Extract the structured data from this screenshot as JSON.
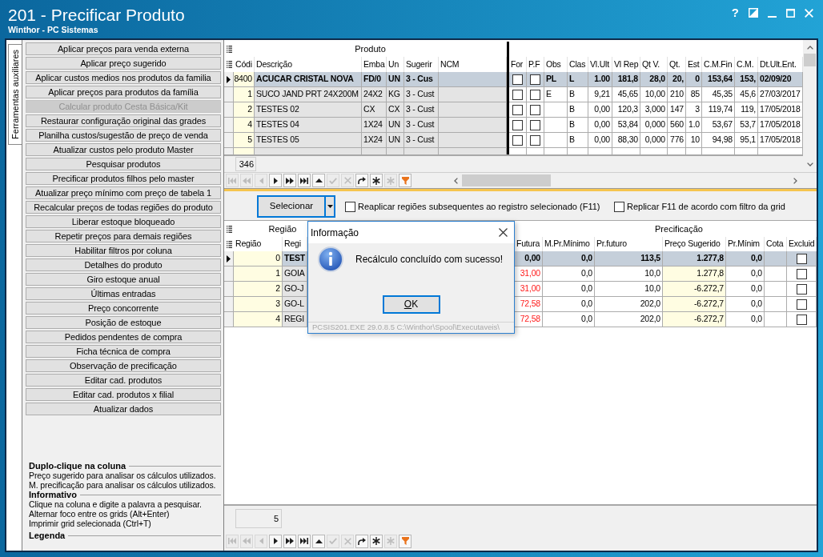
{
  "window": {
    "title": "201 - Precificar Produto",
    "subtitle": "Winthor - PC Sistemas",
    "help": "?"
  },
  "side_tabs": [
    {
      "label": "Ferramentas auxiliares",
      "selected": true
    }
  ],
  "actions": [
    {
      "label": "Aplicar preços para venda externa",
      "disabled": false
    },
    {
      "label": "Aplicar preço sugerido",
      "disabled": false
    },
    {
      "label": "Aplicar custos medios nos produtos da familia",
      "disabled": false
    },
    {
      "label": "Aplicar preços para produtos da família",
      "disabled": false
    },
    {
      "label": "Calcular produto Cesta Básica/Kit",
      "disabled": true
    },
    {
      "label": "Restaurar configuração original das grades",
      "disabled": false
    },
    {
      "label": "Planilha custos/sugestão de preço de venda",
      "disabled": false
    },
    {
      "label": "Atualizar custos pelo produto Master",
      "disabled": false
    },
    {
      "label": "Pesquisar produtos",
      "disabled": false
    },
    {
      "label": "Precificar produtos filhos pelo master",
      "disabled": false
    },
    {
      "label": "Atualizar preço mínimo com preço de tabela 1",
      "disabled": false
    },
    {
      "label": "Recalcular preços de todas regiões do produto",
      "disabled": false
    },
    {
      "label": "Liberar estoque bloqueado",
      "disabled": false
    },
    {
      "label": "Repetir preços para demais regiões",
      "disabled": false
    },
    {
      "label": "Habilitar filtros por coluna",
      "disabled": false
    },
    {
      "label": "Detalhes do produto",
      "disabled": false
    },
    {
      "label": "Giro estoque anual",
      "disabled": false
    },
    {
      "label": "Últimas entradas",
      "disabled": false
    },
    {
      "label": "Preço concorrente",
      "disabled": false
    },
    {
      "label": "Posição de estoque",
      "disabled": false
    },
    {
      "label": "Pedidos pendentes de compra",
      "disabled": false
    },
    {
      "label": "Ficha técnica de compra",
      "disabled": false
    },
    {
      "label": "Observação de precificação",
      "disabled": false
    },
    {
      "label": "Editar cad. produtos",
      "disabled": false
    },
    {
      "label": "Editar cad. produtos x filial",
      "disabled": false
    },
    {
      "label": "Atualizar dados",
      "disabled": false
    }
  ],
  "legend_sections": [
    {
      "heading": "Duplo-clique na coluna",
      "lines": [
        "Preço sugerido para analisar os cálculos utilizados.",
        "M. precificação para analisar os cálculos utilizados."
      ]
    },
    {
      "heading": "Informativo",
      "lines": [
        "Clique na coluna e digite a palavra a pesquisar.",
        "Alternar foco entre os grids (Alt+Enter)",
        "Imprimir grid selecionada (Ctrl+T)"
      ]
    },
    {
      "heading": "Legenda"
    }
  ],
  "product_grid": {
    "band": "Produto",
    "columns": [
      {
        "label": "Códi",
        "kind": "key",
        "highlighted": true
      },
      {
        "label": "Descrição",
        "kind": "text",
        "highlighted": false
      },
      {
        "label": "Emba",
        "kind": "text",
        "highlighted": false
      },
      {
        "label": "Un",
        "kind": "text",
        "highlighted": false
      },
      {
        "label": "Sugerir",
        "kind": "text",
        "highlighted": false
      },
      {
        "label": "NCM",
        "kind": "text",
        "highlighted": false
      },
      {
        "label": "For",
        "kind": "check",
        "highlighted": false
      },
      {
        "label": "P.F",
        "kind": "check",
        "highlighted": false
      },
      {
        "label": "Obs",
        "kind": "text",
        "highlighted": false
      },
      {
        "label": "Clas",
        "kind": "text",
        "highlighted": false
      },
      {
        "label": "Vl.Ult",
        "kind": "number",
        "highlighted": false
      },
      {
        "label": "Vl Rep",
        "kind": "number",
        "highlighted": false
      },
      {
        "label": "Qt V.",
        "kind": "number",
        "highlighted": false
      },
      {
        "label": "Qt.",
        "kind": "number",
        "highlighted": false
      },
      {
        "label": "Est",
        "kind": "number",
        "highlighted": false
      },
      {
        "label": "C.M.Fin",
        "kind": "number",
        "highlighted": false
      },
      {
        "label": "C.M.",
        "kind": "number",
        "highlighted": false
      },
      {
        "label": "Dt.Ult.Ent.",
        "kind": "text",
        "highlighted": false
      }
    ],
    "rows": [
      {
        "selected": true,
        "cells": [
          "8400",
          "ACUCAR CRISTAL NOVA",
          "FD/0",
          "UN",
          "3 - Cus",
          null,
          false,
          false,
          "PL",
          "L",
          "1.00",
          "181,8",
          "28,0",
          "20,",
          "0",
          "153,64",
          "153,",
          "02/09/20"
        ]
      },
      {
        "selected": false,
        "cells": [
          "1",
          "SUCO JAND PRT 24X200M",
          "24X2",
          "KG",
          "3 - Cust",
          null,
          false,
          false,
          "E",
          "B",
          "9,21",
          "45,65",
          "10,00",
          "210",
          "85",
          "45,35",
          "45,6",
          "27/03/2017"
        ]
      },
      {
        "selected": false,
        "cells": [
          "2",
          "TESTES 02",
          "CX",
          "CX",
          "3 - Cust",
          null,
          false,
          false,
          null,
          "B",
          "0,00",
          "120,3",
          "3,000",
          "147",
          "3",
          "119,74",
          "119,",
          "17/05/2018"
        ]
      },
      {
        "selected": false,
        "cells": [
          "4",
          "TESTES 04",
          "1X24",
          "UN",
          "3 - Cust",
          null,
          false,
          false,
          null,
          "B",
          "0,00",
          "53,84",
          "0,000",
          "560",
          "1.0",
          "53,67",
          "53,7",
          "17/05/2018"
        ]
      },
      {
        "selected": false,
        "cells": [
          "5",
          "TESTES 05",
          "1X24",
          "UN",
          "3 - Cust",
          null,
          false,
          false,
          null,
          "B",
          "0,00",
          "88,30",
          "0,000",
          "776",
          "10",
          "94,98",
          "95,1",
          "17/05/2018"
        ]
      }
    ],
    "record_count": "346",
    "navigator": [
      {
        "kind": "first",
        "disabled": true
      },
      {
        "kind": "prior_page",
        "disabled": true
      },
      {
        "kind": "prior",
        "disabled": true
      },
      {
        "kind": "next",
        "disabled": false
      },
      {
        "kind": "next_page",
        "disabled": false
      },
      {
        "kind": "last",
        "disabled": false
      },
      {
        "kind": "insert",
        "disabled": false
      },
      {
        "kind": "post",
        "disabled": true
      },
      {
        "kind": "cancel",
        "disabled": true
      },
      {
        "kind": "refresh",
        "disabled": false
      },
      {
        "kind": "asterisk",
        "disabled": false
      },
      {
        "kind": "asterisk",
        "disabled": true
      },
      {
        "kind": "filter",
        "disabled": false
      }
    ]
  },
  "toolbar": {
    "select_button": "Selecionar",
    "options": [
      {
        "label": "Reaplicar regiões subsequentes ao registro selecionado (F11)",
        "checked": false
      },
      {
        "label": "Replicar F11 de acordo com filtro da grid",
        "checked": false
      }
    ]
  },
  "region_grid": {
    "bands": [
      "Região",
      "Precificação"
    ],
    "columns": [
      {
        "label": "Região",
        "kind": "key",
        "highlighted": true
      },
      {
        "label": "Regi",
        "kind": "text",
        "highlighted": false
      },
      {
        "label": "Futura",
        "kind": "warn_number",
        "highlighted": false
      },
      {
        "label": "M.Pr.Mínimo",
        "kind": "number",
        "highlighted": false
      },
      {
        "label": "Pr.futuro",
        "kind": "number",
        "highlighted": false
      },
      {
        "label": "Preço Sugerido",
        "kind": "number",
        "highlighted": true
      },
      {
        "label": "Pr.Mínim",
        "kind": "number",
        "highlighted": false
      },
      {
        "label": "Cota",
        "kind": "number",
        "highlighted": false
      },
      {
        "label": "Excluid",
        "kind": "check",
        "highlighted": false
      }
    ],
    "rows": [
      {
        "selected": true,
        "warning": false,
        "cells": [
          "0",
          "TEST",
          "0,00",
          "0,0",
          "113,5",
          "1.277,8",
          "0,0",
          null,
          false
        ]
      },
      {
        "selected": false,
        "warning": true,
        "cells": [
          "1",
          "GOIA",
          "31,00",
          "0,0",
          "10,0",
          "1.277,8",
          "0,0",
          null,
          false
        ]
      },
      {
        "selected": false,
        "warning": true,
        "cells": [
          "2",
          "GO-J",
          "31,00",
          "0,0",
          "10,0",
          "-6.272,7",
          "0,0",
          null,
          false
        ]
      },
      {
        "selected": false,
        "warning": true,
        "cells": [
          "3",
          "GO-L",
          "72,58",
          "0,0",
          "202,0",
          "-6.272,7",
          "0,0",
          null,
          false
        ]
      },
      {
        "selected": false,
        "warning": true,
        "cells": [
          "4",
          "REGI",
          "72,58",
          "0,0",
          "202,0",
          "-6.272,7",
          "0,0",
          null,
          false
        ]
      }
    ],
    "record_count": "5",
    "navigator": [
      {
        "kind": "first",
        "disabled": true
      },
      {
        "kind": "prior_page",
        "disabled": true
      },
      {
        "kind": "prior",
        "disabled": true
      },
      {
        "kind": "next",
        "disabled": false
      },
      {
        "kind": "next_page",
        "disabled": false
      },
      {
        "kind": "last",
        "disabled": false
      },
      {
        "kind": "insert",
        "disabled": false
      },
      {
        "kind": "post",
        "disabled": true
      },
      {
        "kind": "cancel",
        "disabled": true
      },
      {
        "kind": "refresh",
        "disabled": false
      },
      {
        "kind": "asterisk",
        "disabled": false
      },
      {
        "kind": "asterisk",
        "disabled": true
      },
      {
        "kind": "filter",
        "disabled": false
      }
    ]
  },
  "dialog": {
    "title": "Informação",
    "message": "Recálculo concluído com sucesso!",
    "button": "OK",
    "footer": "PCSIS201.EXE 29.0.8.5 C:\\Winthor\\Spool\\Executaveis\\"
  }
}
